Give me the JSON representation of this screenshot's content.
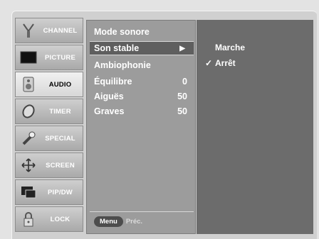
{
  "sidebar": {
    "items": [
      {
        "label": "CHANNEL",
        "icon": "antenna-icon",
        "active": false
      },
      {
        "label": "PICTURE",
        "icon": "screen-icon",
        "active": false
      },
      {
        "label": "AUDIO",
        "icon": "speaker-icon",
        "active": true
      },
      {
        "label": "TIMER",
        "icon": "clock-icon",
        "active": false
      },
      {
        "label": "SPECIAL",
        "icon": "wrench-icon",
        "active": false
      },
      {
        "label": "SCREEN",
        "icon": "move-arrows-icon",
        "active": false
      },
      {
        "label": "PIP/DW",
        "icon": "pip-icon",
        "active": false
      },
      {
        "label": "LOCK",
        "icon": "lock-icon",
        "active": false
      }
    ]
  },
  "audio_menu": {
    "items": [
      {
        "label": "Mode sonore",
        "value": ""
      },
      {
        "label": "Son stable",
        "value": "▶"
      },
      {
        "label": "Ambiophonie",
        "value": ""
      },
      {
        "label": "Équilibre",
        "value": "0"
      },
      {
        "label": "Aiguës",
        "value": "50"
      },
      {
        "label": "Graves",
        "value": "50"
      }
    ],
    "highlighted_index": 1
  },
  "submenu": {
    "options": [
      {
        "label": "Marche",
        "checked": false
      },
      {
        "label": "Arrêt",
        "checked": true
      }
    ],
    "check_symbol": "✓"
  },
  "footer": {
    "menu_button": "Menu",
    "back_label": "Préc."
  },
  "colors": {
    "background": "#e3e3e3",
    "menu_panel": "#9c9c9c",
    "submenu_panel": "#6c6c6c",
    "highlight": "#5f5f5f"
  }
}
